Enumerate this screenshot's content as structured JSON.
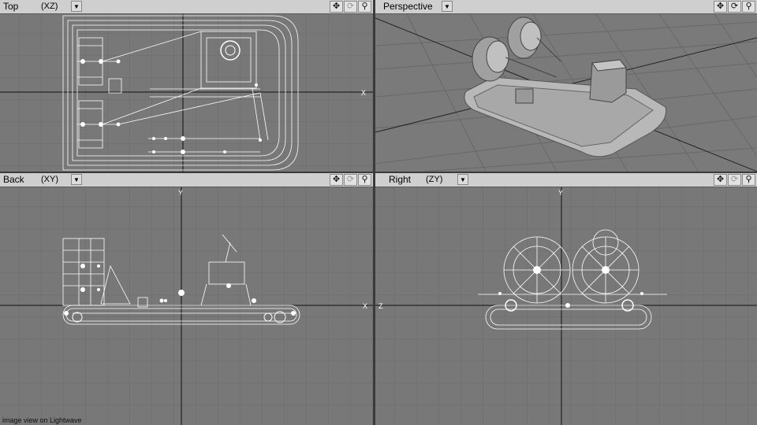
{
  "viewports": {
    "top": {
      "name": "Top",
      "axes": "(XZ)"
    },
    "perspective": {
      "name": "Perspective"
    },
    "back": {
      "name": "Back",
      "axes": "(XY)"
    },
    "right": {
      "name": "Right",
      "axes": "(ZY)"
    }
  },
  "tools": {
    "move_icon": "✥",
    "rotate_icon": "⟳",
    "zoom_icon": "🔍"
  },
  "axis_labels": {
    "x_marker": "X",
    "y_marker": "Y",
    "z_marker": "Z"
  },
  "caption": "image view on Lightwave",
  "colors": {
    "viewport_bg": "#787878",
    "grid": "#6a6a6a",
    "axis": "#111111",
    "wire": "#ffffff",
    "header": "#cfcfcf"
  }
}
